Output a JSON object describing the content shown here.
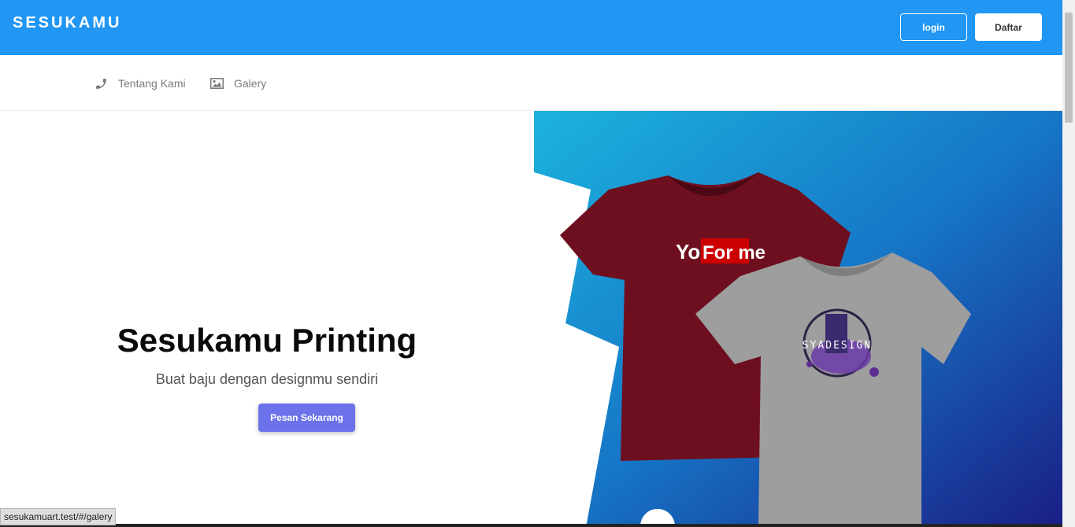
{
  "header": {
    "brand": "SESUKAMU",
    "login_label": "login",
    "daftar_label": "Daftar"
  },
  "subnav": {
    "items": [
      {
        "label": "Tentang Kami",
        "icon": "phone-icon"
      },
      {
        "label": "Galery",
        "icon": "image-icon"
      }
    ]
  },
  "hero": {
    "title": "Sesukamu Printing",
    "subtitle": "Buat baju dengan designmu sendiri",
    "cta_label": "Pesan Sekarang",
    "image": {
      "shirt1_text_a": "You",
      "shirt1_text_b": "For me",
      "shirt2_text": "SYADESIGN"
    }
  },
  "statusbar": {
    "url": "sesukamuart.test/#/galery"
  },
  "colors": {
    "header_bg": "#2196f3",
    "cta_bg": "#6c72ea",
    "shirt_maroon": "#6e0f1f",
    "shirt_grey": "#9e9e9e"
  }
}
